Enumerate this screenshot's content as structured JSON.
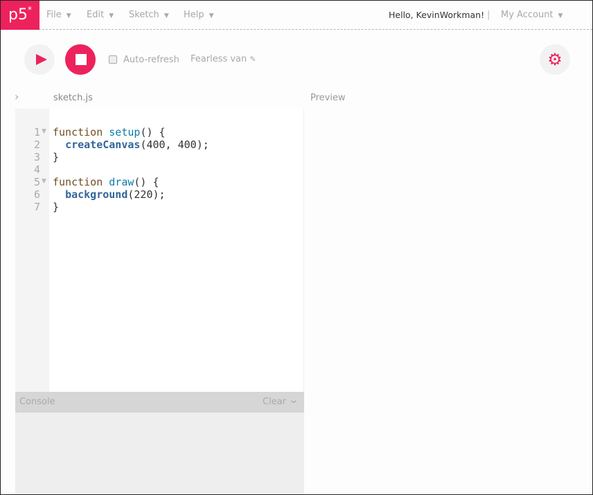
{
  "nav": {
    "logo": "p5",
    "logo_mark": "*",
    "menus": [
      "File",
      "Edit",
      "Sketch",
      "Help"
    ],
    "greeting": "Hello, KevinWorkman!",
    "separator": "|",
    "account": "My Account"
  },
  "toolbar": {
    "auto_refresh": "Auto-refresh",
    "auto_refresh_checked": false,
    "sketch_name": "Fearless van",
    "accent": "#ed225d"
  },
  "editor": {
    "file_tab": "sketch.js",
    "preview_label": "Preview",
    "lines": [
      [
        {
          "t": "function ",
          "c": "kw"
        },
        {
          "t": "setup",
          "c": "fn"
        },
        {
          "t": "() {",
          "c": "pl"
        }
      ],
      [
        {
          "t": "  ",
          "c": "pl"
        },
        {
          "t": "createCanvas",
          "c": "bi"
        },
        {
          "t": "(400, 400);",
          "c": "pl"
        }
      ],
      [
        {
          "t": "}",
          "c": "pl"
        }
      ],
      [],
      [
        {
          "t": "function ",
          "c": "kw"
        },
        {
          "t": "draw",
          "c": "fn"
        },
        {
          "t": "() {",
          "c": "pl"
        }
      ],
      [
        {
          "t": "  ",
          "c": "pl"
        },
        {
          "t": "background",
          "c": "bi"
        },
        {
          "t": "(220);",
          "c": "pl"
        }
      ],
      [
        {
          "t": "}",
          "c": "pl"
        }
      ]
    ],
    "line_numbers": [
      "1",
      "2",
      "3",
      "4",
      "5",
      "6",
      "7"
    ],
    "foldable": [
      1,
      5
    ]
  },
  "console": {
    "title": "Console",
    "clear": "Clear"
  }
}
